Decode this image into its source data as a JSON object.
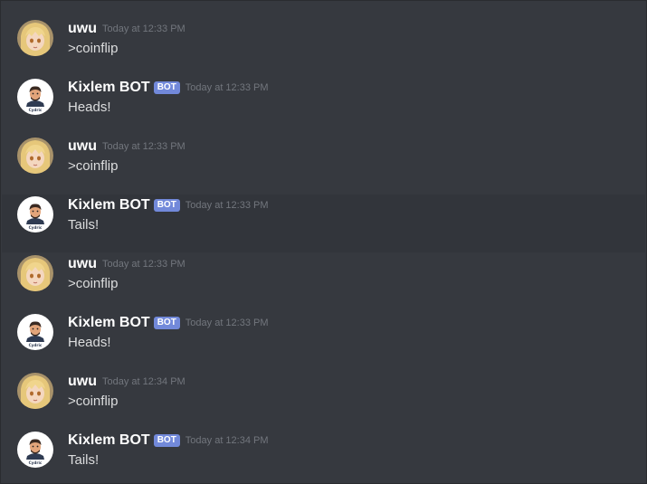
{
  "bot_tag": "BOT",
  "messages": [
    {
      "author": "uwu",
      "time": "Today at 12:33 PM",
      "text": ">coinflip"
    },
    {
      "author": "Kixlem BOT",
      "time": "Today at 12:33 PM",
      "text": "Heads!"
    },
    {
      "author": "uwu",
      "time": "Today at 12:33 PM",
      "text": ">coinflip"
    },
    {
      "author": "Kixlem BOT",
      "time": "Today at 12:33 PM",
      "text": "Tails!"
    },
    {
      "author": "uwu",
      "time": "Today at 12:33 PM",
      "text": ">coinflip"
    },
    {
      "author": "Kixlem BOT",
      "time": "Today at 12:33 PM",
      "text": "Heads!"
    },
    {
      "author": "uwu",
      "time": "Today at 12:34 PM",
      "text": ">coinflip"
    },
    {
      "author": "Kixlem BOT",
      "time": "Today at 12:34 PM",
      "text": "Tails!"
    }
  ],
  "avatars": {
    "user_icon": "anime-girl-avatar",
    "bot_icon": "bot-man-avatar",
    "bot_caption": "Cydric"
  },
  "colors": {
    "background": "#36393f",
    "hover_row": "#32353b",
    "bot_tag": "#7289da",
    "timestamp": "#72767d",
    "username": "#ffffff",
    "message_text": "#dcddde"
  }
}
